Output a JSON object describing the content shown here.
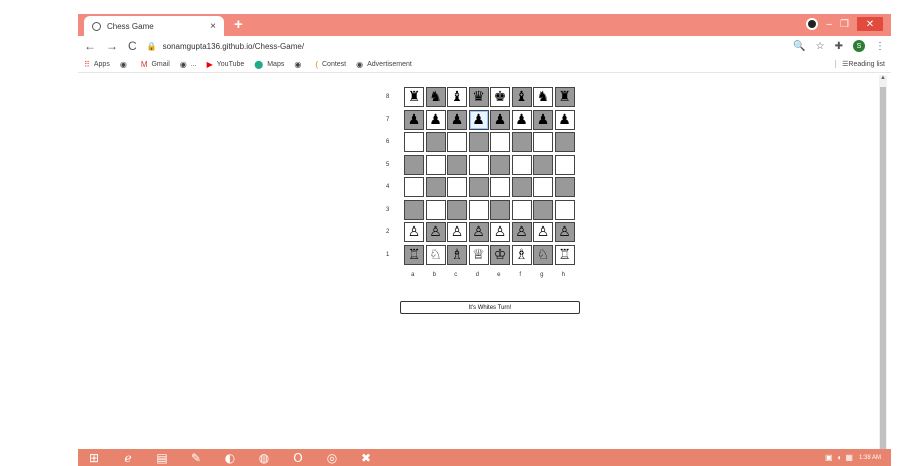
{
  "browser": {
    "tab_title": "Chess Game",
    "tab_close": "×",
    "new_tab": "+",
    "window_controls": {
      "minimize": "–",
      "restore": "❐",
      "close": "✕"
    },
    "url": "sonamgupta136.github.io/Chess-Game/",
    "profile_initial": "S",
    "bookmarks": [
      {
        "label": "Apps",
        "icon": "apps-grid-icon"
      },
      {
        "label": "",
        "icon": "globe-icon"
      },
      {
        "label": "Gmail",
        "icon": "gmail-icon"
      },
      {
        "label": "...",
        "icon": "globe-icon"
      },
      {
        "label": "YouTube",
        "icon": "youtube-icon"
      },
      {
        "label": "Maps",
        "icon": "maps-icon"
      },
      {
        "label": "",
        "icon": "globe-icon"
      },
      {
        "label": "Contest",
        "icon": "contest-icon"
      },
      {
        "label": "Advertisement",
        "icon": "globe-icon"
      }
    ],
    "reading_list": "Reading list"
  },
  "game": {
    "ranks": [
      "8",
      "7",
      "6",
      "5",
      "4",
      "3",
      "2",
      "1"
    ],
    "files": [
      "a",
      "b",
      "c",
      "d",
      "e",
      "f",
      "g",
      "h"
    ],
    "board": [
      [
        "♜",
        "♞",
        "♝",
        "♛",
        "♚",
        "♝",
        "♞",
        "♜"
      ],
      [
        "♟",
        "♟",
        "♟",
        "♟",
        "♟",
        "♟",
        "♟",
        "♟"
      ],
      [
        "",
        "",
        "",
        "",
        "",
        "",
        "",
        ""
      ],
      [
        "",
        "",
        "",
        "",
        "",
        "",
        "",
        ""
      ],
      [
        "",
        "",
        "",
        "",
        "",
        "",
        "",
        ""
      ],
      [
        "",
        "",
        "",
        "",
        "",
        "",
        "",
        ""
      ],
      [
        "♙",
        "♙",
        "♙",
        "♙",
        "♙",
        "♙",
        "♙",
        "♙"
      ],
      [
        "♖",
        "♘",
        "♗",
        "♕",
        "♔",
        "♗",
        "♘",
        "♖"
      ]
    ],
    "turn_text": "It's Whites Turn!"
  },
  "taskbar": {
    "clock": "1:38 AM"
  }
}
